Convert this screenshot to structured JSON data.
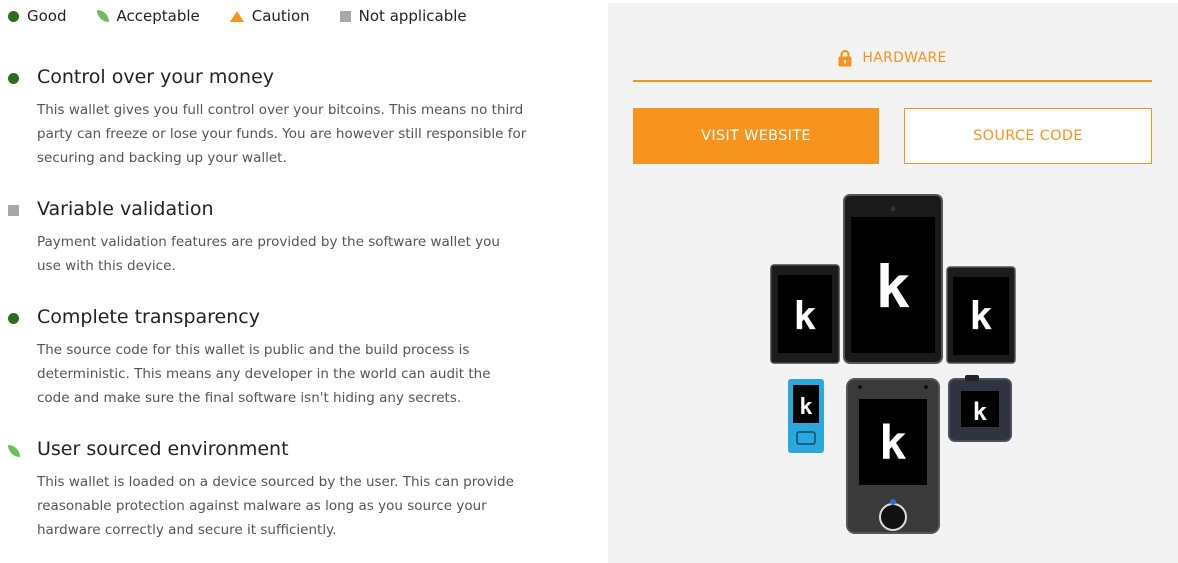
{
  "legend": {
    "items": [
      {
        "label": "Good",
        "color": "#2e6b1f",
        "icon": "circle"
      },
      {
        "label": "Acceptable",
        "color": "#6cbf5a",
        "icon": "leaf"
      },
      {
        "label": "Caution",
        "color": "#f7941d",
        "icon": "triangle"
      },
      {
        "label": "Not applicable",
        "color": "#a8a8a8",
        "icon": "square"
      }
    ]
  },
  "features": [
    {
      "status": "Good",
      "title": "Control over your money",
      "description": "This wallet gives you full control over your bitcoins. This means no third party can freeze or lose your funds. You are however still responsible for securing and backing up your wallet."
    },
    {
      "status": "Not applicable",
      "title": "Variable validation",
      "description": "Payment validation features are provided by the software wallet you use with this device."
    },
    {
      "status": "Good",
      "title": "Complete transparency",
      "description": "The source code for this wallet is public and the build process is deterministic. This means any developer in the world can audit the code and make sure the final software isn't hiding any secrets."
    },
    {
      "status": "Acceptable",
      "title": "User sourced environment",
      "description": "This wallet is loaded on a device sourced by the user. This can provide reasonable protection against malware as long as you source your hardware correctly and secure it sufficiently."
    }
  ],
  "panel": {
    "tab_label": "HARDWARE",
    "tab_icon": "lock-icon",
    "visit_label": "VISIT WEBSITE",
    "source_label": "SOURCE CODE",
    "accent": "#f7941d",
    "device_image": "krux-devices",
    "screen_glyph": "k"
  }
}
